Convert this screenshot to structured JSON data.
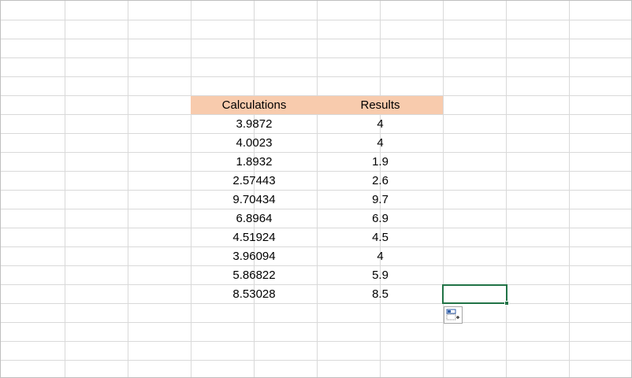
{
  "sheet": {
    "headers": {
      "calculations": "Calculations",
      "results": "Results"
    },
    "rows": [
      {
        "calculation": "3.9872",
        "result": "4"
      },
      {
        "calculation": "4.0023",
        "result": "4"
      },
      {
        "calculation": "1.8932",
        "result": "1.9"
      },
      {
        "calculation": "2.57443",
        "result": "2.6"
      },
      {
        "calculation": "9.70434",
        "result": "9.7"
      },
      {
        "calculation": "6.8964",
        "result": "6.9"
      },
      {
        "calculation": "4.51924",
        "result": "4.5"
      },
      {
        "calculation": "3.96094",
        "result": "4"
      },
      {
        "calculation": "5.86822",
        "result": "5.9"
      },
      {
        "calculation": "8.53028",
        "result": "8.5"
      }
    ]
  },
  "colors": {
    "header_fill": "#f8cbad",
    "gridline": "#d9d9d9",
    "selection": "#217346"
  },
  "icons": {
    "quick_analysis": "quick-analysis-icon"
  }
}
